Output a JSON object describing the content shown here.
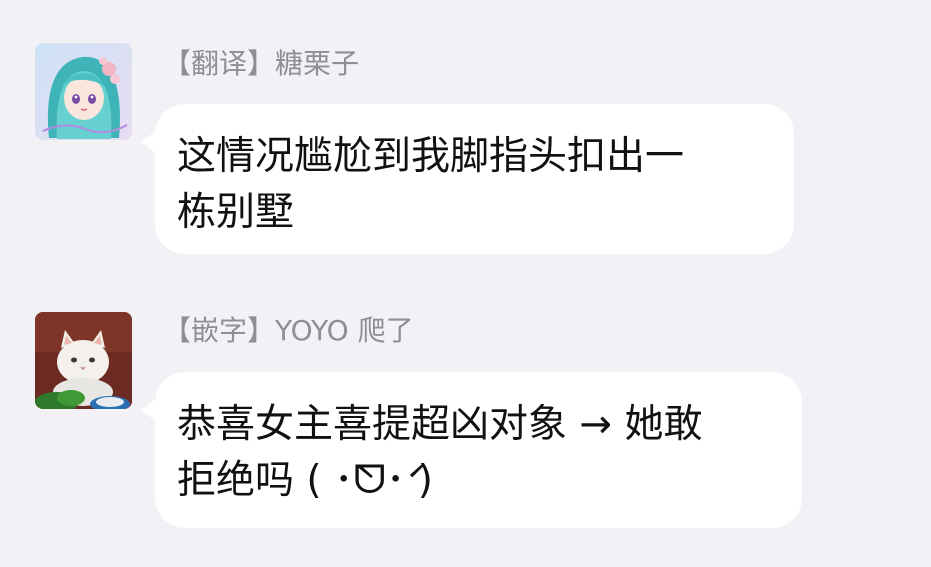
{
  "messages": [
    {
      "sender": "【翻译】糖栗子",
      "avatar_icon": "anime-girl-avatar",
      "lines": [
        "这情况尴尬到我脚指头扣出一",
        "栋别墅"
      ]
    },
    {
      "sender": "【嵌字】YOYO 爬了",
      "avatar_icon": "white-cat-avatar",
      "lines": [
        "恭喜女主喜提超凶对象 → 她敢",
        "拒绝吗 ( ･̀ᗜ･́ )"
      ]
    }
  ],
  "colors": {
    "background": "#f1f1f6",
    "bubble": "#ffffff",
    "sender_text": "#8e8e96",
    "message_text": "#111111"
  }
}
